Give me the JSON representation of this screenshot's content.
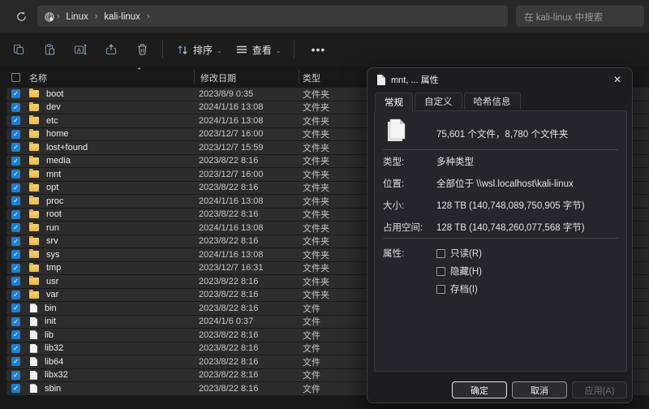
{
  "topbar": {
    "breadcrumbs": [
      "Linux",
      "kali-linux"
    ],
    "search_placeholder": "在 kali-linux 中搜索"
  },
  "toolbar": {
    "sort_label": "排序",
    "view_label": "查看"
  },
  "file_list": {
    "columns": {
      "name": "名称",
      "date": "修改日期",
      "type": "类型"
    },
    "rows": [
      {
        "name": "boot",
        "date": "2023/8/9 0:35",
        "type": "文件夹",
        "kind": "folder"
      },
      {
        "name": "dev",
        "date": "2024/1/16 13:08",
        "type": "文件夹",
        "kind": "folder"
      },
      {
        "name": "etc",
        "date": "2024/1/16 13:08",
        "type": "文件夹",
        "kind": "folder"
      },
      {
        "name": "home",
        "date": "2023/12/7 16:00",
        "type": "文件夹",
        "kind": "folder"
      },
      {
        "name": "lost+found",
        "date": "2023/12/7 15:59",
        "type": "文件夹",
        "kind": "folder"
      },
      {
        "name": "media",
        "date": "2023/8/22 8:16",
        "type": "文件夹",
        "kind": "folder"
      },
      {
        "name": "mnt",
        "date": "2023/12/7 16:00",
        "type": "文件夹",
        "kind": "folder"
      },
      {
        "name": "opt",
        "date": "2023/8/22 8:16",
        "type": "文件夹",
        "kind": "folder"
      },
      {
        "name": "proc",
        "date": "2024/1/16 13:08",
        "type": "文件夹",
        "kind": "folder"
      },
      {
        "name": "root",
        "date": "2023/8/22 8:16",
        "type": "文件夹",
        "kind": "folder"
      },
      {
        "name": "run",
        "date": "2024/1/16 13:08",
        "type": "文件夹",
        "kind": "folder"
      },
      {
        "name": "srv",
        "date": "2023/8/22 8:16",
        "type": "文件夹",
        "kind": "folder"
      },
      {
        "name": "sys",
        "date": "2024/1/16 13:08",
        "type": "文件夹",
        "kind": "folder"
      },
      {
        "name": "tmp",
        "date": "2023/12/7 16:31",
        "type": "文件夹",
        "kind": "folder"
      },
      {
        "name": "usr",
        "date": "2023/8/22 8:16",
        "type": "文件夹",
        "kind": "folder"
      },
      {
        "name": "var",
        "date": "2023/8/22 8:16",
        "type": "文件夹",
        "kind": "folder"
      },
      {
        "name": "bin",
        "date": "2023/8/22 8:16",
        "type": "文件",
        "kind": "file"
      },
      {
        "name": "init",
        "date": "2024/1/6 0:37",
        "type": "文件",
        "kind": "file"
      },
      {
        "name": "lib",
        "date": "2023/8/22 8:16",
        "type": "文件",
        "kind": "file"
      },
      {
        "name": "lib32",
        "date": "2023/8/22 8:16",
        "type": "文件",
        "kind": "file"
      },
      {
        "name": "lib64",
        "date": "2023/8/22 8:16",
        "type": "文件",
        "kind": "file"
      },
      {
        "name": "libx32",
        "date": "2023/8/22 8:16",
        "type": "文件",
        "kind": "file"
      },
      {
        "name": "sbin",
        "date": "2023/8/22 8:16",
        "type": "文件",
        "kind": "file"
      }
    ]
  },
  "dialog": {
    "title": "mnt, ... 属性",
    "tabs": [
      "常规",
      "自定义",
      "哈希信息"
    ],
    "active_tab": "常规",
    "summary": "75,601 个文件，8,780 个文件夹",
    "fields": [
      {
        "label": "类型:",
        "value": "多种类型"
      },
      {
        "label": "位置:",
        "value": "全部位于 \\\\wsl.localhost\\kali-linux"
      },
      {
        "label": "大小:",
        "value": "128 TB (140,748,089,750,905 字节)"
      },
      {
        "label": "占用空间:",
        "value": "128 TB (140,748,260,077,568 字节)"
      }
    ],
    "attributes_label": "属性:",
    "attributes": [
      "只读(R)",
      "隐藏(H)",
      "存档(I)"
    ],
    "buttons": {
      "ok": "确定",
      "cancel": "取消",
      "apply": "应用(A)"
    }
  },
  "colors": {
    "accent": "#1e7fd4",
    "folder": "#f0c04a",
    "selection": "#2c2c2c"
  }
}
